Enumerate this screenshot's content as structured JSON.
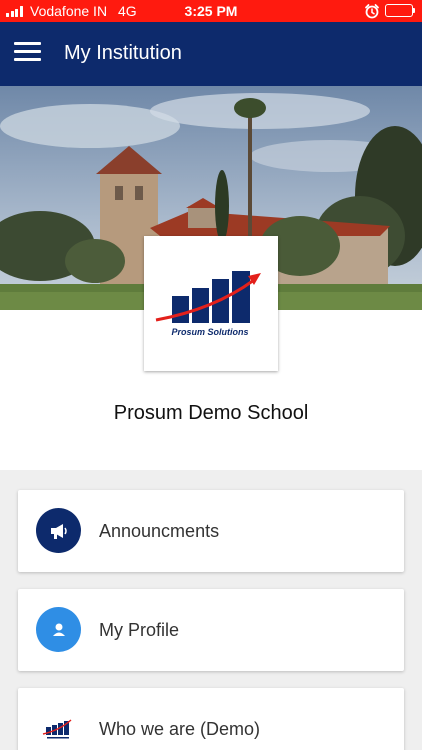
{
  "status_bar": {
    "carrier": "Vodafone IN",
    "network": "4G",
    "time": "3:25 PM",
    "icons": [
      "signal-bars-icon",
      "alarm-icon",
      "battery-icon"
    ]
  },
  "app_bar": {
    "title": "My Institution",
    "menu_icon": "hamburger-menu-icon"
  },
  "institution": {
    "logo_caption": "Prosum Solutions",
    "name": "Prosum Demo School"
  },
  "menu_items": [
    {
      "label": "Announcments",
      "icon": "megaphone-icon",
      "icon_bg": "#0d2a6c"
    },
    {
      "label": "My Profile",
      "icon": "person-icon",
      "icon_bg": "#2f8ee5"
    },
    {
      "label": "Who we are (Demo)",
      "icon": "prosum-logo-icon",
      "icon_bg": "#ffffff"
    }
  ],
  "colors": {
    "status_bar": "#ff1a0f",
    "app_bar": "#0d2a6c",
    "logo_bars": "#0d2a6c",
    "logo_arrow": "#e3201b"
  }
}
